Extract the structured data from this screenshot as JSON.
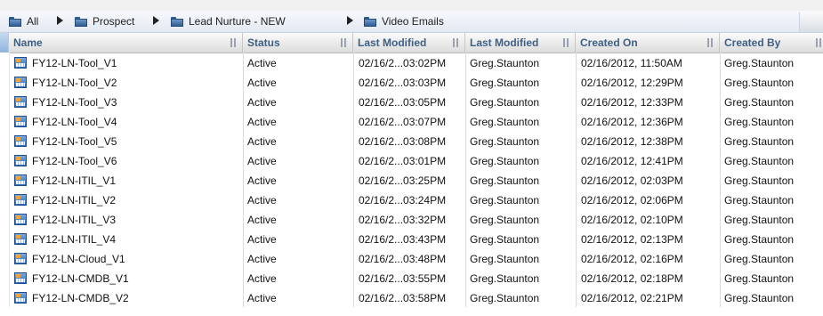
{
  "breadcrumb": {
    "items": [
      {
        "label": "All"
      },
      {
        "label": "Prospect"
      },
      {
        "label": "Lead Nurture - NEW"
      },
      {
        "label": "Video Emails"
      }
    ]
  },
  "table": {
    "columns": [
      {
        "label": "Name"
      },
      {
        "label": "Status"
      },
      {
        "label": "Last Modified"
      },
      {
        "label": "Last Modified"
      },
      {
        "label": "Created On"
      },
      {
        "label": "Created By"
      }
    ],
    "rows": [
      {
        "name": "FY12-LN-Tool_V1",
        "status": "Active",
        "modified": "02/16/2...03:02PM",
        "modified_by": "Greg.Staunton",
        "created_on": "02/16/2012, 11:50AM",
        "created_by": "Greg.Staunton"
      },
      {
        "name": "FY12-LN-Tool_V2",
        "status": "Active",
        "modified": "02/16/2...03:03PM",
        "modified_by": "Greg.Staunton",
        "created_on": "02/16/2012, 12:29PM",
        "created_by": "Greg.Staunton"
      },
      {
        "name": "FY12-LN-Tool_V3",
        "status": "Active",
        "modified": "02/16/2...03:05PM",
        "modified_by": "Greg.Staunton",
        "created_on": "02/16/2012, 12:33PM",
        "created_by": "Greg.Staunton"
      },
      {
        "name": "FY12-LN-Tool_V4",
        "status": "Active",
        "modified": "02/16/2...03:07PM",
        "modified_by": "Greg.Staunton",
        "created_on": "02/16/2012, 12:36PM",
        "created_by": "Greg.Staunton"
      },
      {
        "name": "FY12-LN-Tool_V5",
        "status": "Active",
        "modified": "02/16/2...03:08PM",
        "modified_by": "Greg.Staunton",
        "created_on": "02/16/2012, 12:38PM",
        "created_by": "Greg.Staunton"
      },
      {
        "name": "FY12-LN-Tool_V6",
        "status": "Active",
        "modified": "02/16/2...03:01PM",
        "modified_by": "Greg.Staunton",
        "created_on": "02/16/2012, 12:41PM",
        "created_by": "Greg.Staunton"
      },
      {
        "name": "FY12-LN-ITIL_V1",
        "status": "Active",
        "modified": "02/16/2...03:25PM",
        "modified_by": "Greg.Staunton",
        "created_on": "02/16/2012, 02:03PM",
        "created_by": "Greg.Staunton"
      },
      {
        "name": "FY12-LN-ITIL_V2",
        "status": "Active",
        "modified": "02/16/2...03:24PM",
        "modified_by": "Greg.Staunton",
        "created_on": "02/16/2012, 02:06PM",
        "created_by": "Greg.Staunton"
      },
      {
        "name": "FY12-LN-ITIL_V3",
        "status": "Active",
        "modified": "02/16/2...03:32PM",
        "modified_by": "Greg.Staunton",
        "created_on": "02/16/2012, 02:10PM",
        "created_by": "Greg.Staunton"
      },
      {
        "name": "FY12-LN-ITIL_V4",
        "status": "Active",
        "modified": "02/16/2...03:43PM",
        "modified_by": "Greg.Staunton",
        "created_on": "02/16/2012, 02:13PM",
        "created_by": "Greg.Staunton"
      },
      {
        "name": "FY12-LN-Cloud_V1",
        "status": "Active",
        "modified": "02/16/2...03:48PM",
        "modified_by": "Greg.Staunton",
        "created_on": "02/16/2012, 02:16PM",
        "created_by": "Greg.Staunton"
      },
      {
        "name": "FY12-LN-CMDB_V1",
        "status": "Active",
        "modified": "02/16/2...03:55PM",
        "modified_by": "Greg.Staunton",
        "created_on": "02/16/2012, 02:18PM",
        "created_by": "Greg.Staunton"
      },
      {
        "name": "FY12-LN-CMDB_V2",
        "status": "Active",
        "modified": "02/16/2...03:58PM",
        "modified_by": "Greg.Staunton",
        "created_on": "02/16/2012, 02:21PM",
        "created_by": "Greg.Staunton"
      }
    ]
  },
  "icons": {
    "breadcrumb_folder": "folder-icon",
    "breadcrumb_separator": "arrow-right-icon",
    "row_item": "email-program-icon"
  },
  "colors": {
    "header_text": "#3f5f85",
    "sorted_header": "#8fb4de",
    "folder": "#2f5e93"
  }
}
